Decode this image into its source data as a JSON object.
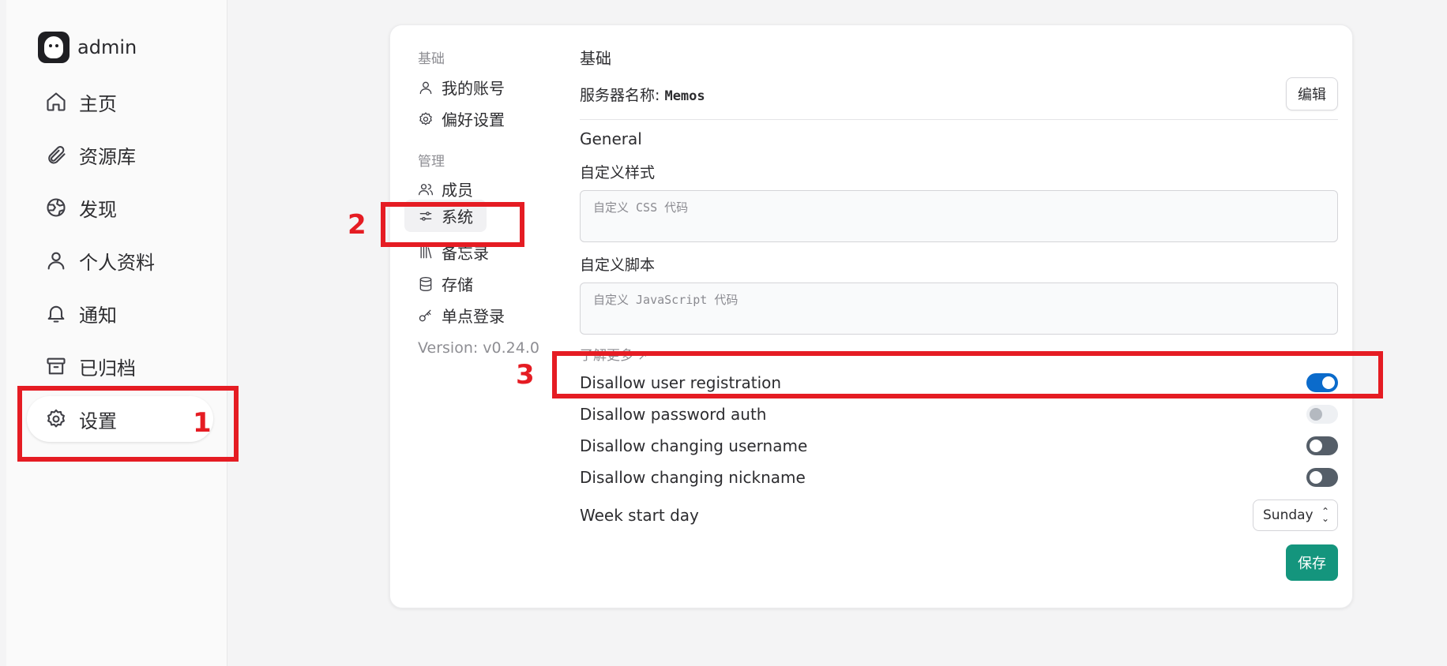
{
  "sidebar": {
    "user_name": "admin",
    "items": [
      {
        "label": "主页",
        "icon": "home-icon"
      },
      {
        "label": "资源库",
        "icon": "paperclip-icon"
      },
      {
        "label": "发现",
        "icon": "globe-icon"
      },
      {
        "label": "个人资料",
        "icon": "user-icon"
      },
      {
        "label": "通知",
        "icon": "bell-icon"
      },
      {
        "label": "已归档",
        "icon": "archive-icon"
      },
      {
        "label": "设置",
        "icon": "gear-icon",
        "active": true
      }
    ]
  },
  "settings_nav": {
    "group_basic": "基础",
    "group_admin": "管理",
    "items": [
      {
        "label": "我的账号",
        "icon": "user-icon"
      },
      {
        "label": "偏好设置",
        "icon": "gear-icon"
      },
      {
        "label": "成员",
        "icon": "users-icon"
      },
      {
        "label": "系统",
        "icon": "sliders-icon",
        "active": true
      },
      {
        "label": "备忘录",
        "icon": "library-icon"
      },
      {
        "label": "存储",
        "icon": "database-icon"
      },
      {
        "label": "单点登录",
        "icon": "key-icon"
      }
    ],
    "version": "Version: v0.24.0"
  },
  "system": {
    "basic_title": "基础",
    "server_name_label": "服务器名称:",
    "server_name_value": "Memos",
    "edit_label": "编辑",
    "general_title": "General",
    "custom_style_label": "自定义样式",
    "custom_style_placeholder": "自定义 CSS 代码",
    "custom_script_label": "自定义脚本",
    "custom_script_placeholder": "自定义 JavaScript 代码",
    "learn_more": "了解更多",
    "toggles": [
      {
        "label": "Disallow user registration",
        "state": "on"
      },
      {
        "label": "Disallow password auth",
        "state": "disabled"
      },
      {
        "label": "Disallow changing username",
        "state": "off"
      },
      {
        "label": "Disallow changing nickname",
        "state": "off"
      }
    ],
    "week_start_label": "Week start day",
    "week_start_value": "Sunday",
    "save_label": "保存"
  },
  "annotations": [
    "1",
    "2",
    "3"
  ],
  "colors": {
    "accent_blue": "#0b6bcb",
    "save_green": "#14957d",
    "annotation_red": "#e51c23"
  }
}
